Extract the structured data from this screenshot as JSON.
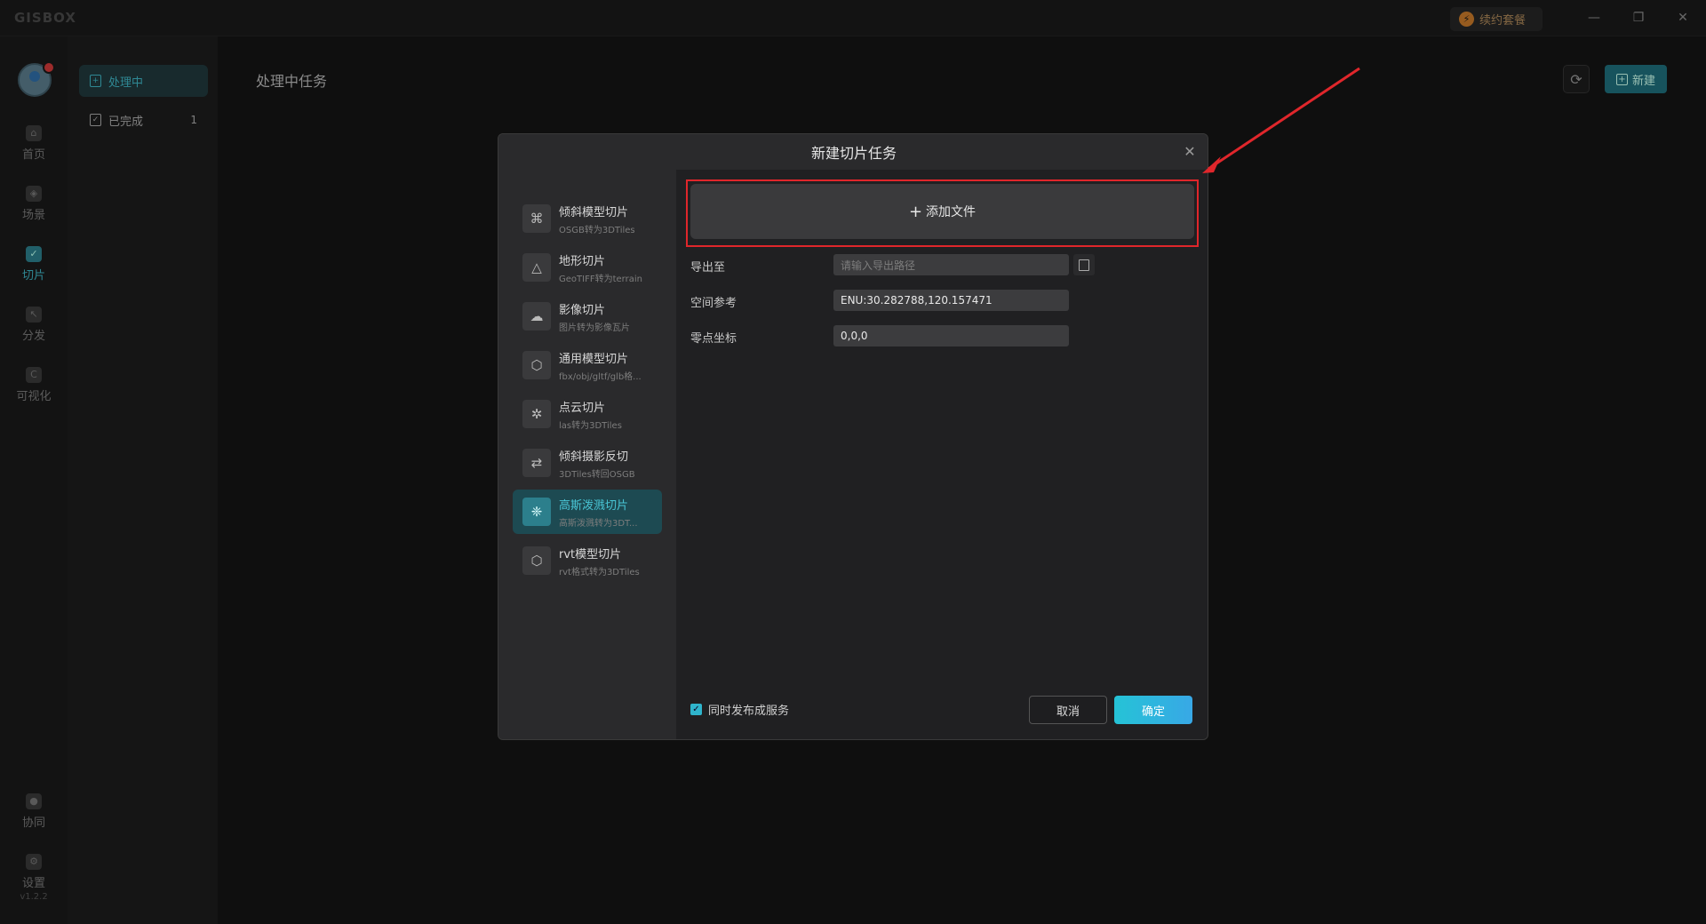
{
  "app": {
    "logo": "GISBOX",
    "renew_label": "续约套餐",
    "version": "v1.2.2"
  },
  "window_controls": {
    "minimize": "—",
    "restore": "❐",
    "close": "✕"
  },
  "rail": {
    "items": [
      {
        "label": "首页",
        "icon": "home-icon"
      },
      {
        "label": "场景",
        "icon": "scene-icon"
      },
      {
        "label": "切片",
        "icon": "tile-icon",
        "active": true
      },
      {
        "label": "分发",
        "icon": "distribute-icon"
      },
      {
        "label": "可视化",
        "icon": "visualize-icon"
      },
      {
        "label": "协同",
        "icon": "collaborate-icon"
      },
      {
        "label": "设置",
        "icon": "settings-icon"
      }
    ]
  },
  "subnav": {
    "items": [
      {
        "label": "处理中",
        "active": true
      },
      {
        "label": "已完成",
        "count": "1"
      }
    ]
  },
  "page": {
    "title": "处理中任务",
    "new_label": "新建"
  },
  "modal": {
    "title": "新建切片任务",
    "types": [
      {
        "title": "倾斜模型切片",
        "subtitle": "OSGB转为3DTiles"
      },
      {
        "title": "地形切片",
        "subtitle": "GeoTIFF转为terrain"
      },
      {
        "title": "影像切片",
        "subtitle": "图片转为影像瓦片"
      },
      {
        "title": "通用模型切片",
        "subtitle": "fbx/obj/gltf/glb格..."
      },
      {
        "title": "点云切片",
        "subtitle": "las转为3DTiles"
      },
      {
        "title": "倾斜摄影反切",
        "subtitle": "3DTiles转回OSGB"
      },
      {
        "title": "高斯泼溅切片",
        "subtitle": "高斯泼溅转为3DT...",
        "active": true
      },
      {
        "title": "rvt模型切片",
        "subtitle": "rvt格式转为3DTiles"
      }
    ],
    "add_file_label": "添加文件",
    "form": {
      "export_label": "导出至",
      "export_placeholder": "请输入导出路径",
      "crs_label": "空间参考",
      "crs_value": "ENU:30.282788,120.157471",
      "origin_label": "零点坐标",
      "origin_value": "0,0,0"
    },
    "publish_label": "同时发布成服务",
    "cancel_label": "取消",
    "ok_label": "确定"
  },
  "colors": {
    "accent": "#2fb4cc",
    "highlight_frame": "#e0262b",
    "arrow": "#e0262b"
  }
}
